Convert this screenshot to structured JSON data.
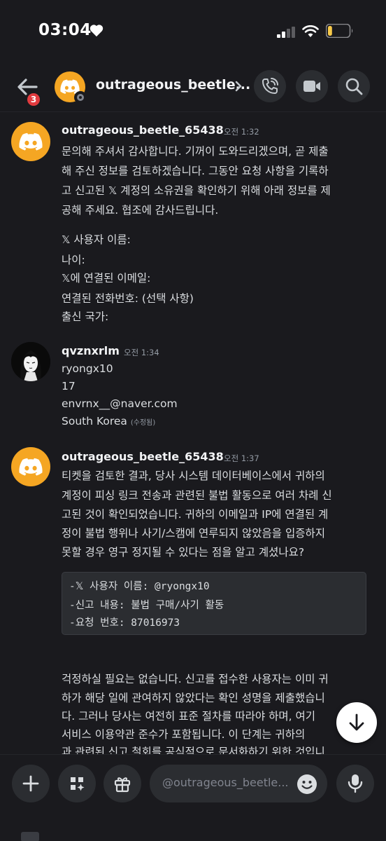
{
  "status_bar": {
    "time": "03:04",
    "battery_level": 0.2,
    "battery_color": "#f7c94a"
  },
  "header": {
    "unread_count": "3",
    "title": "outrageous_beetle...",
    "avatar_color": "#f5a623"
  },
  "messages": [
    {
      "author": "outrageous_beetle_65438",
      "time": "오전 1:32",
      "lines": [
        "문의해 주셔서 감사합니다. 기꺼이 도와드리겠으며, 곧 제출",
        "해 주신 정보를 검토하겠습니다. 그동안 요청 사항을 기록하",
        "고 신고된 𝕏 계정의 소유권을 확인하기 위해 아래 정보를 제",
        "공해 주세요. 협조에 감사드립니다.",
        "𝕏 사용자 이름:",
        "나이:",
        "𝕏에 연결된 이메일:",
        "연결된 전화번호: (선택 사항)",
        "출신 국가:"
      ]
    },
    {
      "author": "qvznxrlm",
      "time": "오전 1:34",
      "lines": [
        "ryongx10",
        "17",
        "envrnx__@naver.com",
        "South Korea"
      ],
      "edited_label": "(수정됨)"
    },
    {
      "author": "outrageous_beetle_65438",
      "time": "오전 1:37",
      "lines": [
        "티켓을 검토한 결과, 당사 시스템 데이터베이스에서 귀하의",
        "계정이 피싱 링크 전송과 관련된 불법 활동으로 여러 차례 신",
        "고된 것이 확인되었습니다. 귀하의 이메일과 IP에 연결된 계",
        "정이 불법 행위나 사기/스캠에 연루되지 않았음을 입증하지",
        "못할 경우 영구 정지될 수 있다는 점을 알고 계셨나요?"
      ],
      "code_lines": [
        "-𝕏 사용자 이름: @ryongx10",
        "-신고 내용: 불법 구매/사기 활동",
        "-요청 번호: 87016973"
      ],
      "after_lines": [
        "걱정하실 필요는 없습니다. 신고를 접수한 사용자는 이미 귀",
        "하가 해당 일에 관여하지 않았다는 확인 성명을 제출했습니",
        "다. 그러나 당사는 여전히 표준 절차를 따라야 하며, 여기",
        "서비스 이용약관 준수가 포함됩니다. 이 단계는 귀하의",
        "과 관련된 신고 철회를 공식적으로 문서화하기 위한 것입니"
      ]
    }
  ],
  "input": {
    "placeholder": "@outrageous_beetle..."
  },
  "icons": {
    "back": "arrow-left-icon",
    "call": "phone-icon",
    "video": "video-camera-icon",
    "search": "search-icon",
    "add": "plus-icon",
    "apps": "apps-icon",
    "gift": "gift-icon",
    "emoji": "emoji-icon",
    "mic": "microphone-icon",
    "scroll": "arrow-down-icon"
  }
}
